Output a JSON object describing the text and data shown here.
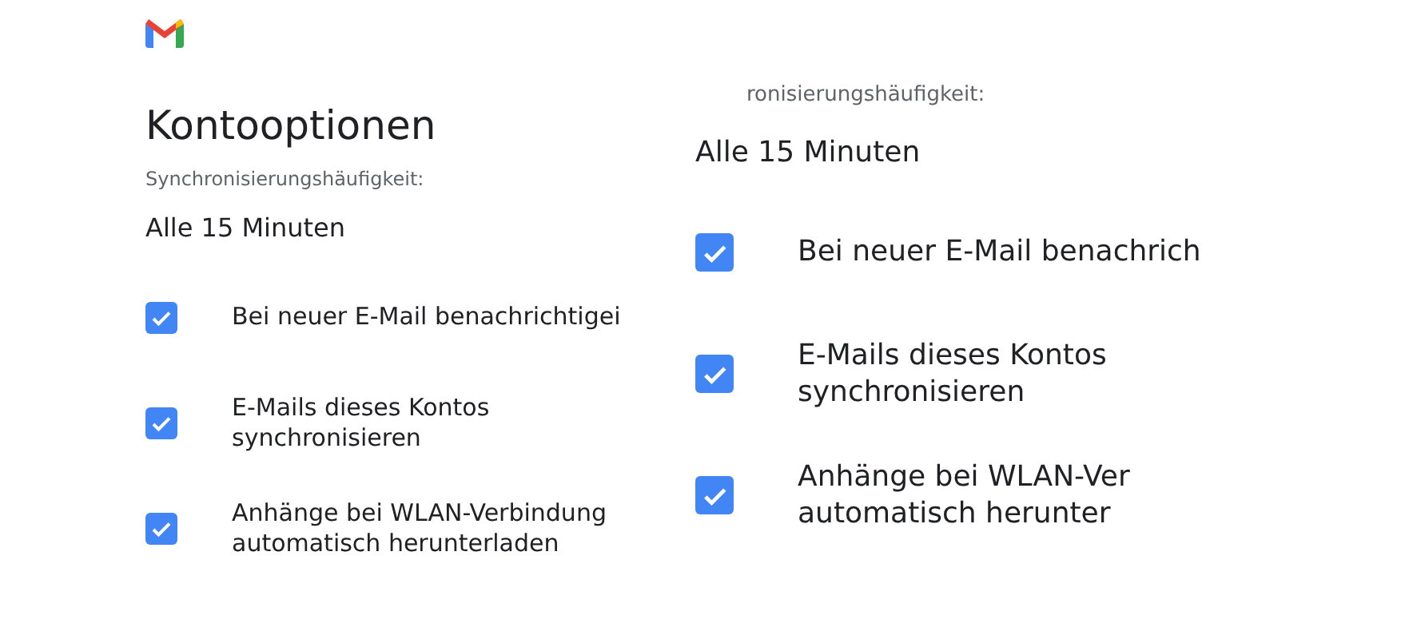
{
  "panels": [
    {
      "kind": "normal",
      "title": "Kontooptionen",
      "subtitle": "Synchronisierungshäufigkeit:",
      "value": "Alle 15 Minuten",
      "options": [
        {
          "label": "Bei neuer E-Mail benachrichtigei",
          "checked": true
        },
        {
          "label": "E-Mails dieses Kontos synchronisieren",
          "checked": true
        },
        {
          "label": "Anhänge bei WLAN-Verbindung automatisch herunterladen",
          "checked": true
        }
      ]
    },
    {
      "kind": "zoomed",
      "subtitle": "ronisierungshäufigkeit:",
      "value": "Alle 15 Minuten",
      "options": [
        {
          "label": "Bei neuer E-Mail benachrich",
          "checked": true
        },
        {
          "label": "E-Mails dieses Kontos synchronisieren",
          "checked": true
        },
        {
          "label": "Anhänge bei WLAN-Ver automatisch herunter",
          "checked": true
        }
      ]
    }
  ]
}
